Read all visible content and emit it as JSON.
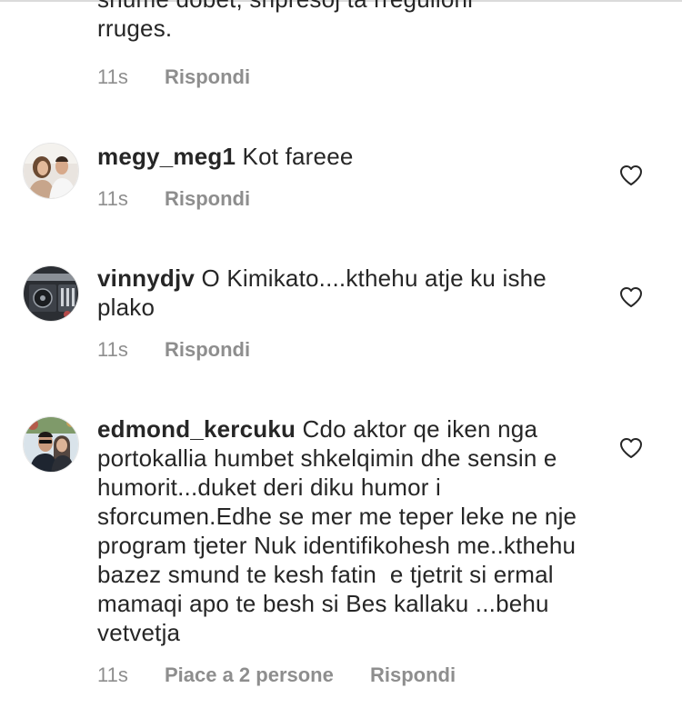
{
  "comments": [
    {
      "username": "",
      "lines": [
        "shume dobet, shpresoj ta rregulloni",
        "rruges."
      ],
      "time": "11s",
      "likes_label": "",
      "reply_label": "Rispondi"
    },
    {
      "username": "megy_meg1",
      "text": "Kot fareee",
      "time": "11s",
      "likes_label": "",
      "reply_label": "Rispondi"
    },
    {
      "username": "vinnydjv",
      "text": "O Kimikato....kthehu atje ku ishe plako",
      "time": "11s",
      "likes_label": "",
      "reply_label": "Rispondi"
    },
    {
      "username": "edmond_kercuku",
      "text": "Cdo aktor qe iken nga portokallia humbet shkelqimin dhe sensin e humorit...duket deri diku humor i sforcumen.Edhe se mer me teper leke ne nje  program tjeter Nuk identifikohesh me..kthehu bazez smund te kesh fatin  e tjetrit si ermal mamaqi apo te besh si Bes kallaku ...behu vetvetja",
      "time": "11s",
      "likes_label": "Piace a 2 persone",
      "reply_label": "Rispondi"
    }
  ],
  "icons": {
    "like": "heart-outline-icon"
  },
  "colors": {
    "text": "#262626",
    "meta": "#8e8e8e",
    "divider": "#dbdbdb"
  }
}
